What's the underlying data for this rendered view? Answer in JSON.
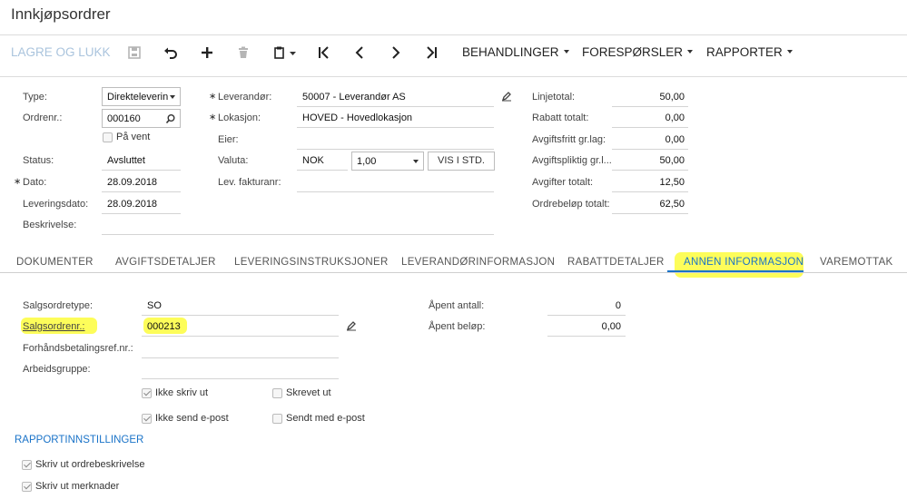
{
  "window": {
    "title": "Innkjøpsordrer"
  },
  "toolbar": {
    "save_close": "LAGRE OG LUKK",
    "processing": "BEHANDLINGER",
    "inquiries": "FORESPØRSLER",
    "reports": "RAPPORTER"
  },
  "header": {
    "type_label": "Type:",
    "type_value": "Direkteleverin",
    "order_no_label": "Ordrenr.:",
    "order_no_value": "000160",
    "on_hold_label": "På vent",
    "status_label": "Status:",
    "status_value": "Avsluttet",
    "date_label": "Dato:",
    "date_value": "28.09.2018",
    "delivery_date_label": "Leveringsdato:",
    "delivery_date_value": "28.09.2018",
    "description_label": "Beskrivelse:",
    "vendor_label": "Leverandør:",
    "vendor_value": "50007 - Leverandør AS",
    "location_label": "Lokasjon:",
    "location_value": "HOVED - Hovedlokasjon",
    "owner_label": "Eier:",
    "currency_label": "Valuta:",
    "currency_value": "NOK",
    "rate_value": "1,00",
    "base_button": "VIS I STD.",
    "vendor_invoice_label": "Lev. fakturanr:"
  },
  "totals": [
    {
      "label": "Linjetotal:",
      "value": "50,00"
    },
    {
      "label": "Rabatt totalt:",
      "value": "0,00"
    },
    {
      "label": "Avgiftsfritt gr.lag:",
      "value": "0,00"
    },
    {
      "label": "Avgiftspliktig gr.l...",
      "value": "50,00"
    },
    {
      "label": "Avgifter totalt:",
      "value": "12,50"
    },
    {
      "label": "Ordrebeløp totalt:",
      "value": "62,50"
    }
  ],
  "tabs": [
    "DOKUMENTER",
    "AVGIFTSDETALJER",
    "LEVERINGSINSTRUKSJONER",
    "LEVERANDØRINFORMASJON",
    "RABATTDETALJER",
    "ANNEN INFORMASJON",
    "VAREMOTTAK"
  ],
  "other_info": {
    "so_type_label": "Salgsordretype:",
    "so_type_value": "SO",
    "so_no_label": "Salgsordrenr.:",
    "so_no_value": "000213",
    "prepay_label": "Forhåndsbetalingsref.nr.:",
    "workgroup_label": "Arbeidsgruppe:",
    "open_qty_label": "Åpent antall:",
    "open_qty_value": "0",
    "open_amount_label": "Åpent beløp:",
    "open_amount_value": "0,00",
    "dont_print": "Ikke skriv ut",
    "printed": "Skrevet ut",
    "dont_email": "Ikke send e-post",
    "emailed": "Sendt med e-post"
  },
  "report_settings": {
    "heading": "RAPPORTINNSTILLINGER",
    "print_desc": "Skriv ut ordrebeskrivelse",
    "print_notes": "Skriv ut merknader"
  },
  "colors": {
    "accent": "#1a73c8",
    "highlight": "#fdfd5a",
    "disabled": "#aac4dd"
  }
}
